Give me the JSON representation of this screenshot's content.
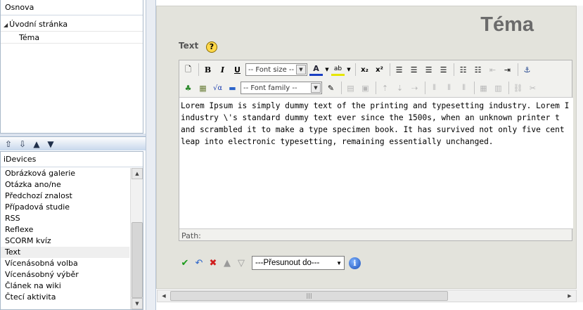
{
  "outline": {
    "header": "Osnova",
    "root": "Úvodní stránka",
    "child": "Téma"
  },
  "arrows": [
    "⇧",
    "⇩",
    "▲",
    "▼"
  ],
  "idevices": {
    "header": "iDevices",
    "items": [
      "Obrázková galerie",
      "Otázka ano/ne",
      "Předchozí znalost",
      "Případová studie",
      "RSS",
      "Reflexe",
      "SCORM kvíz",
      "Text",
      "Vícenásobná volba",
      "Vícenásobný výběr",
      "Článek na wiki",
      "Čtecí aktivita"
    ],
    "selected": "Text"
  },
  "page": {
    "title": "Téma",
    "field_label": "Text",
    "help": "?"
  },
  "editor": {
    "font_size_placeholder": "-- Font size --",
    "font_family_placeholder": "-- Font family --",
    "lines": [
      "Lorem Ipsum is simply dummy text of the printing and typesetting industry. Lorem I",
      "industry \\'s standard dummy text ever since the 1500s, when an unknown printer t",
      "and scrambled it to make a type specimen book. It has survived not only five cent",
      "leap into electronic typesetting, remaining essentially unchanged."
    ],
    "path_label": "Path:"
  },
  "actions": {
    "move_select": "---Přesunout do---",
    "info": "i"
  },
  "icons": {
    "ok": "check-icon",
    "undo": "undo-icon",
    "delete": "delete-icon",
    "up": "move-up-icon",
    "down": "move-down-icon"
  },
  "colors": {
    "content_bg": "#e3e3dc",
    "title": "#6b6b6b",
    "ok": "#1a9b1a",
    "delete": "#d01e1e",
    "undo": "#2a63c9"
  }
}
